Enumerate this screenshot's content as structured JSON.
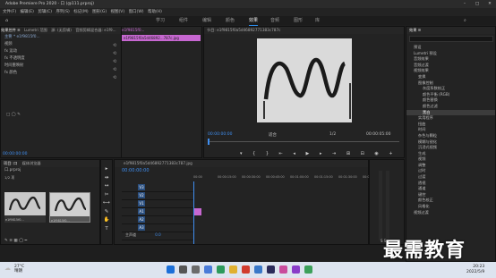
{
  "title_bar": {
    "title": "Adobe Premiere Pro 2020 - 口 (@111.prproj)"
  },
  "menu": [
    "文件(F)",
    "编辑(E)",
    "剪辑(C)",
    "序列(S)",
    "标记(M)",
    "图形(G)",
    "视图(V)",
    "窗口(W)",
    "帮助(H)"
  ],
  "workspace_tabs": [
    {
      "label": "学习",
      "active": false
    },
    {
      "label": "组件",
      "active": false
    },
    {
      "label": "编辑",
      "active": false
    },
    {
      "label": "颜色",
      "active": false
    },
    {
      "label": "效果",
      "active": true
    },
    {
      "label": "音频",
      "active": false
    },
    {
      "label": "图形",
      "active": false
    },
    {
      "label": "库",
      "active": false
    }
  ],
  "effect_controls": {
    "tabs": [
      "效果控件 ≡",
      "Lumetri 范围",
      "源: (无剪辑)",
      "音频剪辑混合器: e1f9..."
    ],
    "source_label": "主要 * e1f9815f0...",
    "clip_label": "e1f9815f0...",
    "section_label": "视频",
    "rows": [
      "fx  运动",
      "fx  不透明度",
      "    时间重映射",
      "fx  颜色"
    ],
    "timecode": "00:00:00:00",
    "clip_bar": "e1f9815f0a5d46892...787c.jpg"
  },
  "program_monitor": {
    "tab": "节目: e1f9815f0a5d46892771383c787c",
    "timecode_left": "00:00:00:00",
    "fit": "适合",
    "fraction": "1/2",
    "timecode_right": "00:00:05:00"
  },
  "project_panel": {
    "tabs": [
      "项目: 口",
      "媒体浏览器"
    ],
    "file_label": "口.prproj",
    "count": "1/2 项",
    "items": [
      {
        "name": "e1f9815f0...",
        "duration": "5:00"
      },
      {
        "name": "e1f9815f0...",
        "duration": "5:00"
      }
    ]
  },
  "timeline": {
    "tab": "e1f9815f0a5d46892771383c787.jpg",
    "timecode": "00:00:00:00",
    "ruler": [
      "00:00",
      "00:00:15:00",
      "00:00:30:00",
      "00:00:45:00",
      "00:01:00:00",
      "00:01:15:00",
      "00:01:30:00",
      "00:01:45:00"
    ],
    "video_tracks": [
      "V3",
      "V2",
      "V1"
    ],
    "audio_tracks": [
      "A1",
      "A2",
      "A3"
    ],
    "master_label": "主声道",
    "master_value": "0.0"
  },
  "effects_panel": {
    "tab": "效果 ≡",
    "tree": [
      {
        "label": "预设",
        "indent": 1,
        "sel": false
      },
      {
        "label": "Lumetri 预设",
        "indent": 1,
        "sel": false
      },
      {
        "label": "音频效果",
        "indent": 1,
        "sel": false
      },
      {
        "label": "音频过渡",
        "indent": 1,
        "sel": false
      },
      {
        "label": "视频效果",
        "indent": 1,
        "sel": false
      },
      {
        "label": "变换",
        "indent": 2,
        "sel": false
      },
      {
        "label": "图像控制",
        "indent": 2,
        "sel": false
      },
      {
        "label": "灰度系数校正",
        "indent": 3,
        "sel": false
      },
      {
        "label": "颜色平衡 (RGB)",
        "indent": 3,
        "sel": false
      },
      {
        "label": "颜色替换",
        "indent": 3,
        "sel": false
      },
      {
        "label": "颜色过滤",
        "indent": 3,
        "sel": false
      },
      {
        "label": "黑白",
        "indent": 3,
        "sel": true
      },
      {
        "label": "实用程序",
        "indent": 2,
        "sel": false
      },
      {
        "label": "扭曲",
        "indent": 2,
        "sel": false
      },
      {
        "label": "时间",
        "indent": 2,
        "sel": false
      },
      {
        "label": "杂色与颗粒",
        "indent": 2,
        "sel": false
      },
      {
        "label": "模糊与锐化",
        "indent": 2,
        "sel": false
      },
      {
        "label": "沉浸式视频",
        "indent": 2,
        "sel": false
      },
      {
        "label": "生成",
        "indent": 2,
        "sel": false
      },
      {
        "label": "视频",
        "indent": 2,
        "sel": false
      },
      {
        "label": "调整",
        "indent": 2,
        "sel": false
      },
      {
        "label": "过时",
        "indent": 2,
        "sel": false
      },
      {
        "label": "过渡",
        "indent": 2,
        "sel": false
      },
      {
        "label": "透视",
        "indent": 2,
        "sel": false
      },
      {
        "label": "通道",
        "indent": 2,
        "sel": false
      },
      {
        "label": "键控",
        "indent": 2,
        "sel": false
      },
      {
        "label": "颜色校正",
        "indent": 2,
        "sel": false
      },
      {
        "label": "风格化",
        "indent": 2,
        "sel": false
      },
      {
        "label": "视频过渡",
        "indent": 1,
        "sel": false
      }
    ]
  },
  "right_tabs": [
    "基本图形",
    "基本声音",
    "Lumetri 颜色",
    "库",
    "标记",
    "历史记录",
    "信息"
  ],
  "watermark": "最需教育",
  "taskbar": {
    "temp": "27°C",
    "weather": "晴朗",
    "time": "20:23",
    "date": "2022/5/9"
  },
  "colors": {
    "accent": "#2d8ceb",
    "clip_pink": "#c767d1",
    "track_blue": "#2a4f80",
    "timecode_blue": "#3f8ef0"
  }
}
